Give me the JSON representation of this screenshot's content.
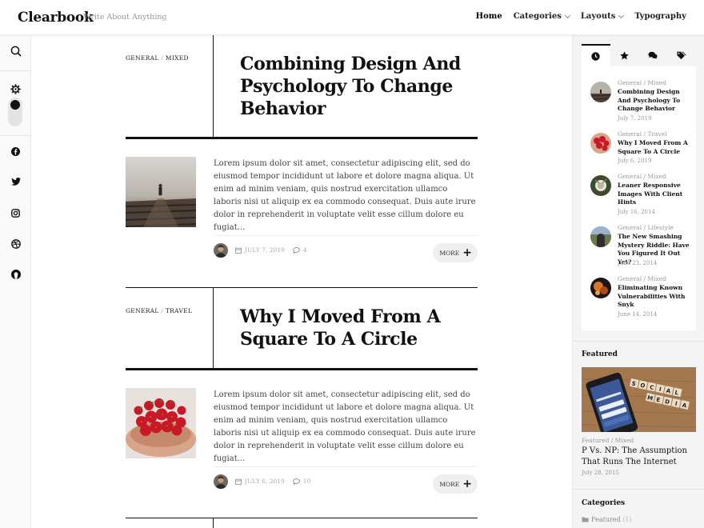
{
  "site": {
    "name": "Clearbook",
    "tagline": "Write About Anything"
  },
  "nav": {
    "items": [
      {
        "label": "Home",
        "dropdown": false,
        "active": true
      },
      {
        "label": "Categories",
        "dropdown": true
      },
      {
        "label": "Layouts",
        "dropdown": true
      },
      {
        "label": "Typography",
        "dropdown": false
      }
    ]
  },
  "leftbar": {
    "icons": [
      "search-icon",
      "gear-icon",
      "theme-toggle",
      "facebook-icon",
      "twitter-icon",
      "instagram-icon",
      "dribbble-icon",
      "github-icon"
    ]
  },
  "articles": [
    {
      "category_1": "General",
      "separator": "/",
      "category_2": "Mixed",
      "title": "Combining Design And Psychology To Change Behavior",
      "excerpt": "Lorem ipsum dolor sit amet, consectetur adipiscing elit, sed do eiusmod tempor incididunt ut labore et dolore magna aliqua. Ut enim ad minim veniam, quis nostrud exercitation ullamco laboris nisi ut aliquip ex ea commodo consequat. Duis aute irure dolor in reprehenderit in voluptate velit esse cillum dolore eu fugiat...",
      "date": "July 7, 2019",
      "comments": "4",
      "more": "More"
    },
    {
      "category_1": "General",
      "separator": "/",
      "category_2": "Travel",
      "title": "Why I Moved From A Square To A Circle",
      "excerpt": "Lorem ipsum dolor sit amet, consectetur adipiscing elit, sed do eiusmod tempor incididunt ut labore et dolore magna aliqua. Ut enim ad minim veniam, quis nostrud exercitation ullamco laboris nisi ut aliquip ex ea commodo consequat. Duis aute irure dolor in reprehenderit in voluptate velit esse cillum dolore eu fugiat...",
      "date": "July 6, 2019",
      "comments": "10",
      "more": "More"
    }
  ],
  "sidebar": {
    "tabs": [
      "clock-icon",
      "star-icon",
      "comments-icon",
      "tags-icon"
    ],
    "recent": [
      {
        "category": "General / Mixed",
        "title": "Combining Design And Psychology To Change Behavior",
        "date": "July 7, 2019"
      },
      {
        "category": "General / Travel",
        "title": "Why I Moved From A Square To A Circle",
        "date": "July 6, 2019"
      },
      {
        "category": "General / Mixed",
        "title": "Leaner Responsive Images With Client Hints",
        "date": "July 16, 2014"
      },
      {
        "category": "General / Lifestyle",
        "title": "The New Smashing Mystery Riddle: Have You Figured It Out Yet?",
        "date": "June 23, 2014"
      },
      {
        "category": "General / Mixed",
        "title": "Eliminating Known Vulnerabilities With Snyk",
        "date": "June 14, 2014"
      }
    ],
    "featured_heading": "Featured",
    "featured": {
      "category": "Featured / Mixed",
      "title": "P Vs. NP: The Assumption That Runs The Internet",
      "date": "July 28, 2015"
    },
    "categories_heading": "Categories",
    "categories": [
      {
        "label": "Featured",
        "count": "(1)"
      }
    ]
  }
}
